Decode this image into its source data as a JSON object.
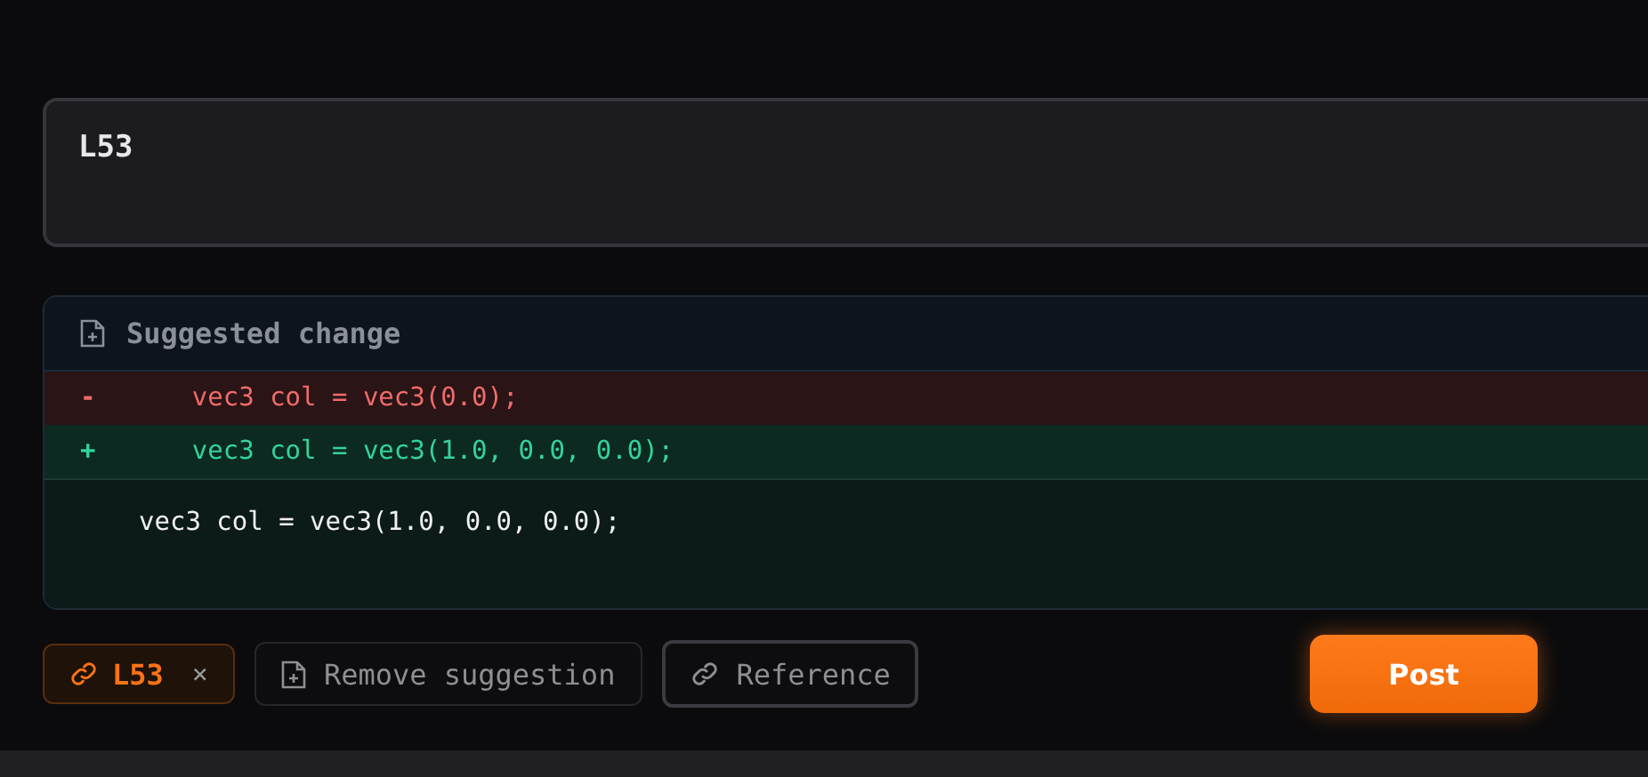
{
  "comment": {
    "value": "L53"
  },
  "suggestion": {
    "title": "Suggested change",
    "lines": [
      {
        "kind": "del",
        "sign": "-",
        "code": "    vec3 col = vec3(0.0);"
      },
      {
        "kind": "add",
        "sign": "+",
        "code": "    vec3 col = vec3(1.0, 0.0, 0.0);"
      }
    ],
    "preview": "vec3 col = vec3(1.0, 0.0, 0.0);"
  },
  "toolbar": {
    "reference_chip": {
      "label": "L53",
      "remove": "×"
    },
    "buttons": [
      {
        "kind": "suggest",
        "label": "Remove suggestion",
        "highlighted": false
      },
      {
        "kind": "link",
        "label": "Reference",
        "highlighted": true
      }
    ],
    "post": "Post"
  }
}
